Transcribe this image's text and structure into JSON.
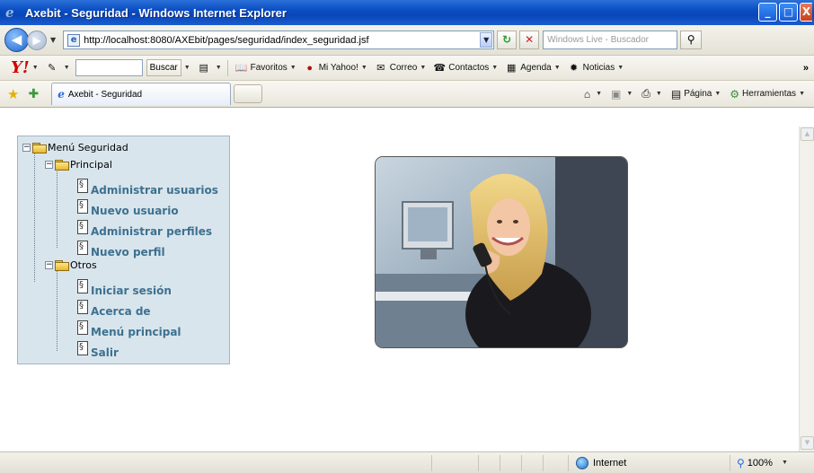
{
  "window": {
    "title": "Axebit - Seguridad - Windows Internet Explorer",
    "controls": [
      "_",
      "□",
      "X"
    ]
  },
  "address_bar": {
    "url": "http://localhost:8080/AXEbit/pages/seguridad/index_seguridad.jsf",
    "search_placeholder": "Windows Live - Buscador"
  },
  "yahoo_toolbar": {
    "logo": "Y!",
    "search_button": "Buscar",
    "items": [
      {
        "label": "Favoritos",
        "icon": "book-icon"
      },
      {
        "label": "Mi Yahoo!",
        "icon": "my-yahoo-icon"
      },
      {
        "label": "Correo",
        "icon": "mail-icon"
      },
      {
        "label": "Contactos",
        "icon": "contacts-icon"
      },
      {
        "label": "Agenda",
        "icon": "calendar-icon"
      },
      {
        "label": "Noticias",
        "icon": "news-icon"
      }
    ],
    "more": "»"
  },
  "tab_bar": {
    "tab_title": "Axebit - Seguridad",
    "tools": [
      {
        "label": "",
        "icon": "home-icon"
      },
      {
        "label": "",
        "icon": "feeds-icon"
      },
      {
        "label": "",
        "icon": "print-icon"
      },
      {
        "label": "Página",
        "icon": "page-icon"
      },
      {
        "label": "Herramientas",
        "icon": "tools-icon"
      }
    ]
  },
  "menu_tree": {
    "root": "Menú Seguridad",
    "groups": [
      {
        "label": "Principal",
        "items": [
          "Administrar usuarios",
          "Nuevo usuario",
          "Administrar perfiles",
          "Nuevo perfil"
        ]
      },
      {
        "label": "Otros",
        "items": [
          "Iniciar sesión",
          "Acerca de",
          "Menú principal",
          "Salir"
        ]
      }
    ]
  },
  "status_bar": {
    "zone": "Internet",
    "zoom": "100%"
  }
}
